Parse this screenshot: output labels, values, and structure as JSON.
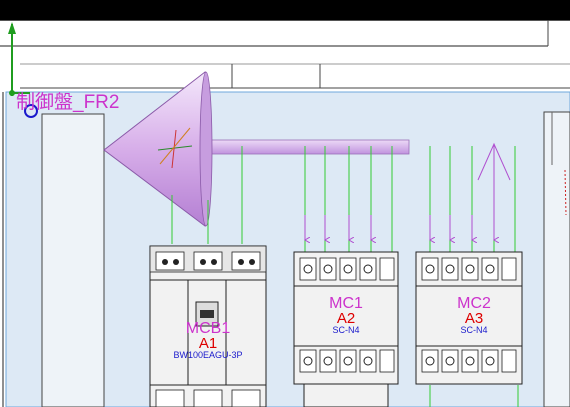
{
  "panel": {
    "title": "制御盤_FR2"
  },
  "components": {
    "mcb1": {
      "name": "MCB1",
      "ref": "A1",
      "model": "BW100EAGU-3P"
    },
    "mc1": {
      "name": "MC1",
      "ref": "A2",
      "model": "SC-N4"
    },
    "mc2": {
      "name": "MC2",
      "ref": "A3",
      "model": "SC-N4"
    }
  },
  "colors": {
    "background": "#ffffff",
    "panel_fill": "#dde9f5",
    "frame_black": "#000000",
    "wire_green": "#33cc33",
    "label_magenta": "#cc33cc",
    "label_red": "#dd0000",
    "label_blue": "#1a1acc",
    "cone_purple": "#d8b0ec",
    "axis_green": "#1f9d1f",
    "device_grey": "#f2f2f2"
  },
  "icons": {
    "origin": "origin-axis-icon",
    "cone": "cone-shape-icon",
    "snap": "snap-circle-icon"
  }
}
